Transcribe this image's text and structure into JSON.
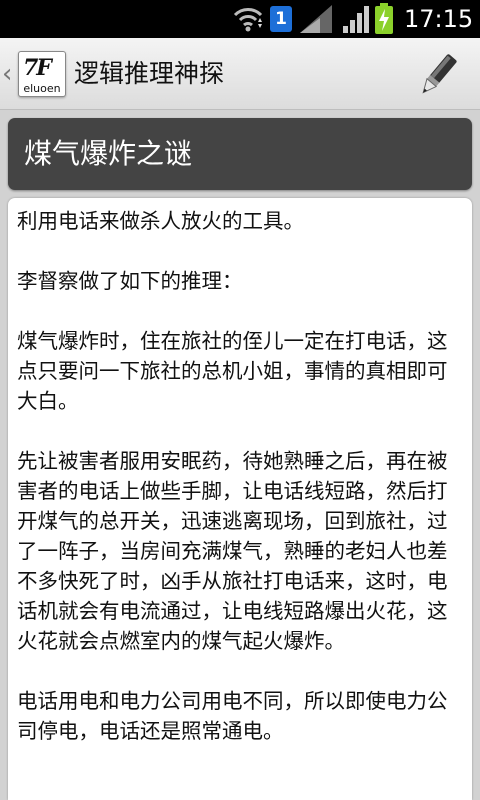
{
  "status_bar": {
    "notification_count": "1",
    "time": "17:15",
    "icons": [
      "wifi-icon",
      "notification-icon",
      "signal-icon",
      "signal-icon",
      "battery-charging-icon"
    ],
    "colors": {
      "notification": "#1d6fd8",
      "battery": "#8bd12b"
    }
  },
  "action_bar": {
    "back_icon": "back-chevron-icon",
    "logo": {
      "mark": "7F",
      "text": "eluoen"
    },
    "title": "逻辑推理神探",
    "edit_icon": "pen-icon"
  },
  "article": {
    "title": "煤气爆炸之谜",
    "body": "利用电话来做杀人放火的工具。\n\n李督察做了如下的推理：\n\n煤气爆炸时，住在旅社的侄儿一定在打电话，这点只要问一下旅社的总机小姐，事情的真相即可大白。\n\n先让被害者服用安眠药，待她熟睡之后，再在被害者的电话上做些手脚，让电话线短路，然后打开煤气的总开关，迅速逃离现场，回到旅社，过了一阵子，当房间充满煤气，熟睡的老妇人也差不多快死了时，凶手从旅社打电话来，这时，电话机就会有电流通过，让电线短路爆出火花，这火花就会点燃室内的煤气起火爆炸。\n\n电话用电和电力公司用电不同，所以即使电力公司停电，电话还是照常通电。"
  }
}
